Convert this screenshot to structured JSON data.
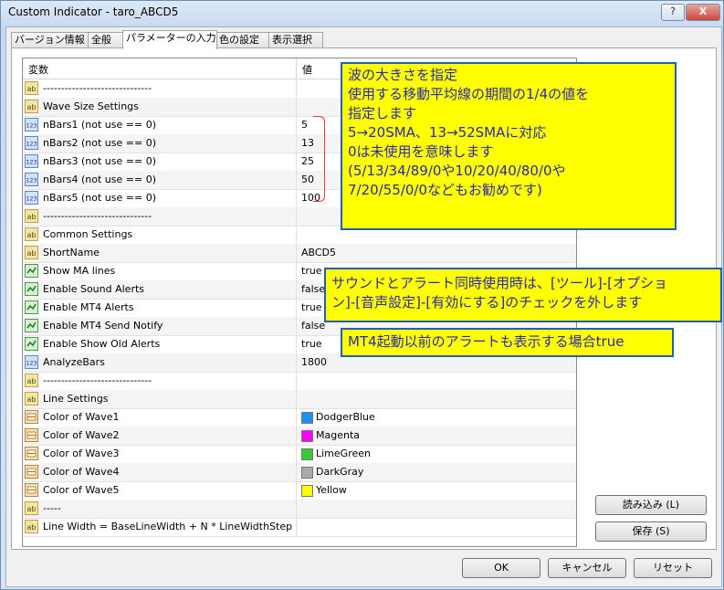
{
  "window": {
    "title": "Custom Indicator - taro_ABCD5",
    "help_label": "?",
    "close_label": "X"
  },
  "tabs": [
    {
      "label": "バージョン情報"
    },
    {
      "label": "全般"
    },
    {
      "label": "パラメーターの入力"
    },
    {
      "label": "色の設定"
    },
    {
      "label": "表示選択"
    }
  ],
  "grid": {
    "col_name": "変数",
    "col_value": "値",
    "rows": [
      {
        "icon": "ab",
        "name": "------------------------------",
        "value": ""
      },
      {
        "icon": "ab",
        "name": "Wave Size Settings",
        "value": ""
      },
      {
        "icon": "123",
        "name": "nBars1 (not use == 0)",
        "value": "5"
      },
      {
        "icon": "123",
        "name": "nBars2 (not use == 0)",
        "value": "13"
      },
      {
        "icon": "123",
        "name": "nBars3 (not use == 0)",
        "value": "25"
      },
      {
        "icon": "123",
        "name": "nBars4 (not use == 0)",
        "value": "50"
      },
      {
        "icon": "123",
        "name": "nBars5 (not use == 0)",
        "value": "100"
      },
      {
        "icon": "ab",
        "name": "------------------------------",
        "value": ""
      },
      {
        "icon": "ab",
        "name": "Common Settings",
        "value": ""
      },
      {
        "icon": "ab",
        "name": "ShortName",
        "value": "ABCD5"
      },
      {
        "icon": "bool",
        "name": "Show MA lines",
        "value": "true"
      },
      {
        "icon": "bool",
        "name": "Enable Sound Alerts",
        "value": "false"
      },
      {
        "icon": "bool",
        "name": "Enable MT4 Alerts",
        "value": "true"
      },
      {
        "icon": "bool",
        "name": "Enable MT4 Send Notify",
        "value": "false"
      },
      {
        "icon": "bool",
        "name": "Enable Show Old Alerts",
        "value": "true"
      },
      {
        "icon": "123",
        "name": "AnalyzeBars",
        "value": "1800"
      },
      {
        "icon": "ab",
        "name": "------------------------------",
        "value": ""
      },
      {
        "icon": "ab",
        "name": "Line Settings",
        "value": ""
      },
      {
        "icon": "color",
        "name": "Color of Wave1",
        "value": "DodgerBlue",
        "swatch": "#1e90ff"
      },
      {
        "icon": "color",
        "name": "Color of Wave2",
        "value": "Magenta",
        "swatch": "#ff00ff"
      },
      {
        "icon": "color",
        "name": "Color of Wave3",
        "value": "LimeGreen",
        "swatch": "#32cd32"
      },
      {
        "icon": "color",
        "name": "Color of Wave4",
        "value": "DarkGray",
        "swatch": "#a9a9a9"
      },
      {
        "icon": "color",
        "name": "Color of Wave5",
        "value": "Yellow",
        "swatch": "#ffff00"
      },
      {
        "icon": "ab",
        "name": "-----",
        "value": ""
      },
      {
        "icon": "ab",
        "name": "Line Width = BaseLineWidth + N * LineWidthStep",
        "value": ""
      }
    ]
  },
  "buttons": {
    "load": "読み込み (L)",
    "save": "保存 (S)",
    "ok": "OK",
    "cancel": "キャンセル",
    "reset": "リセット"
  },
  "notes": {
    "wave_size": [
      "波の大きさを指定",
      "使用する移動平均線の期間の1/4の値を",
      "指定します",
      "5→20SMA、13→52SMAに対応",
      "0は未使用を意味します",
      "(5/13/34/89/0や10/20/40/80/0や",
      "7/20/55/0/0などもお勧めです)"
    ],
    "sound": [
      "サウンドとアラート同時使用時は、[ツール]-[オプショ",
      "ン]-[音声設定]-[有効にする]のチェックを外します"
    ],
    "old_alerts": "MT4起動以前のアラートも表示する場合true"
  },
  "icons": {
    "text": "ab-icon",
    "number": "123-icon",
    "bool": "bool-icon",
    "color": "color-icon"
  }
}
